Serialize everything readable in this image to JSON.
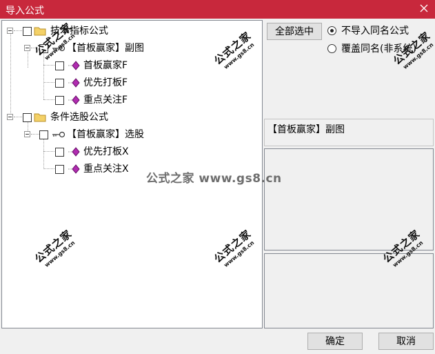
{
  "window": {
    "title": "导入公式",
    "close_icon": "close-icon"
  },
  "tree": {
    "groups": [
      {
        "label": "技术指标公式",
        "icon": "folder-icon",
        "formula": {
          "label": "【首板赢家】副图",
          "icon": "key-icon",
          "children": [
            {
              "label": "首板赢家F",
              "icon": "gem-icon"
            },
            {
              "label": "优先打板F",
              "icon": "gem-icon"
            },
            {
              "label": "重点关注F",
              "icon": "gem-icon"
            }
          ]
        }
      },
      {
        "label": "条件选股公式",
        "icon": "folder-icon",
        "formula": {
          "label": "【首板赢家】选股",
          "icon": "key-icon",
          "children": [
            {
              "label": "优先打板X",
              "icon": "gem-icon"
            },
            {
              "label": "重点关注X",
              "icon": "gem-icon"
            }
          ]
        }
      }
    ]
  },
  "right": {
    "select_all_label": "全部选中",
    "radio_options": [
      {
        "label": "不导入同名公式",
        "checked": true
      },
      {
        "label": "覆盖同名(非系统)",
        "checked": false
      }
    ],
    "selected_formula": "【首板赢家】副图"
  },
  "footer": {
    "ok_label": "确定",
    "cancel_label": "取消"
  },
  "watermark": {
    "big": "公式之家",
    "small": "www.gs8.cn",
    "center": "公式之家 www.gs8.cn"
  }
}
